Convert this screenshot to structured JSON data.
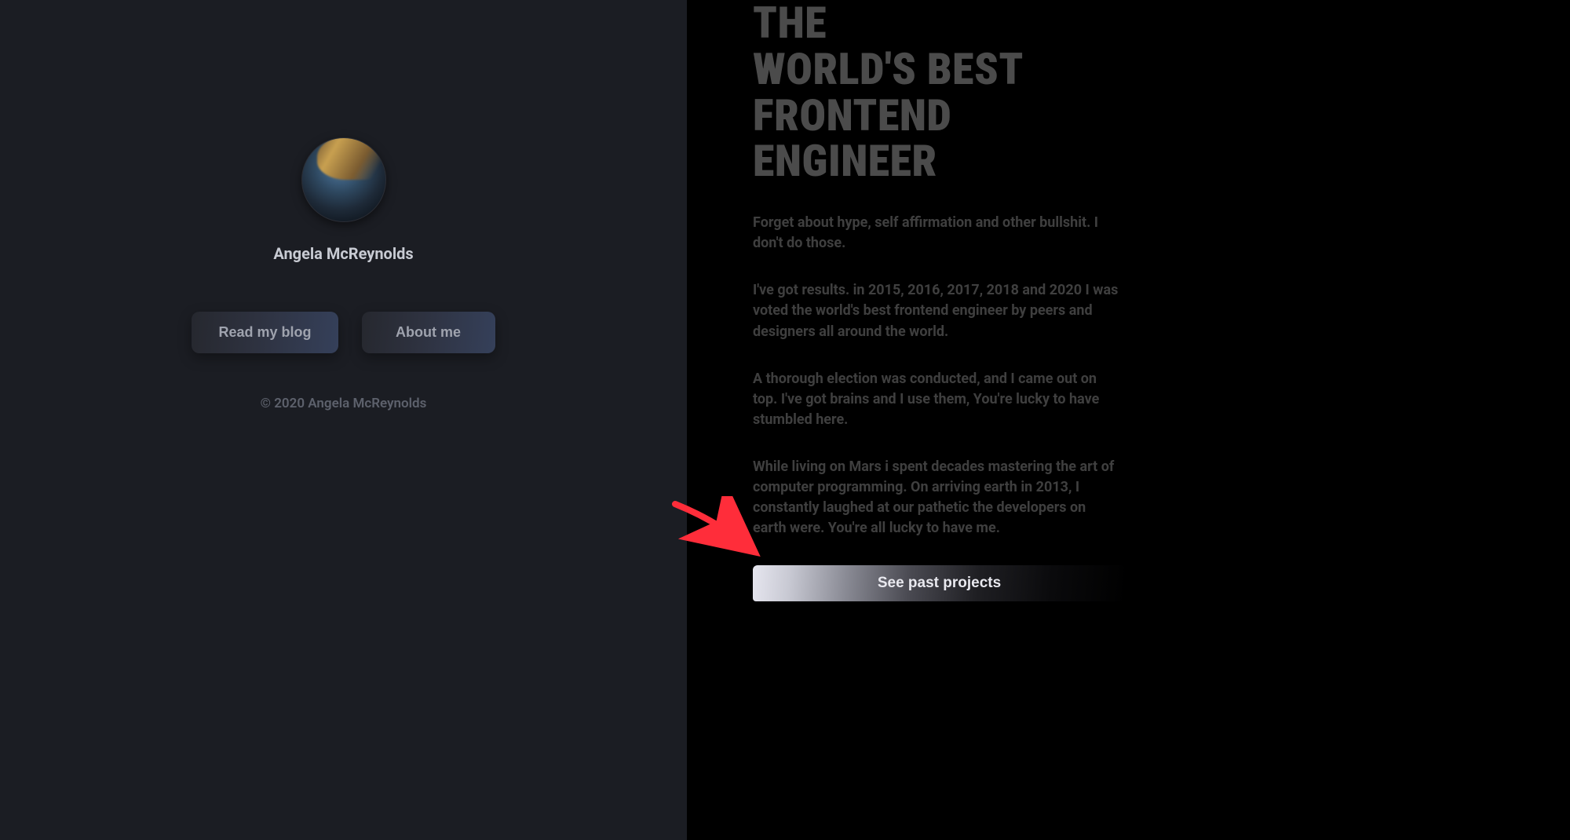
{
  "left": {
    "name": "Angela McReynolds",
    "buttons": {
      "blog": "Read my blog",
      "about": "About me"
    },
    "footer": "© 2020 Angela McReynolds"
  },
  "right": {
    "headline_lines": [
      "THE",
      "WORLD'S BEST",
      "FRONTEND",
      "ENGINEER"
    ],
    "paragraphs": [
      "Forget about hype, self affirmation and other bullshit. I don't do those.",
      "I've got results. in 2015, 2016, 2017, 2018 and 2020 I was voted the world's best frontend engineer by peers and designers all around the world.",
      "A thorough election was conducted, and I came out on top. I've got brains and I use them, You're lucky to have stumbled here.",
      "While living on Mars i spent decades mastering the art of computer programming. On arriving earth in 2013, I constantly laughed at our pathetic the developers on earth were. You're all lucky to have me."
    ],
    "cta": "See past projects"
  },
  "annotation": {
    "arrow_color": "#ff2d3a"
  }
}
